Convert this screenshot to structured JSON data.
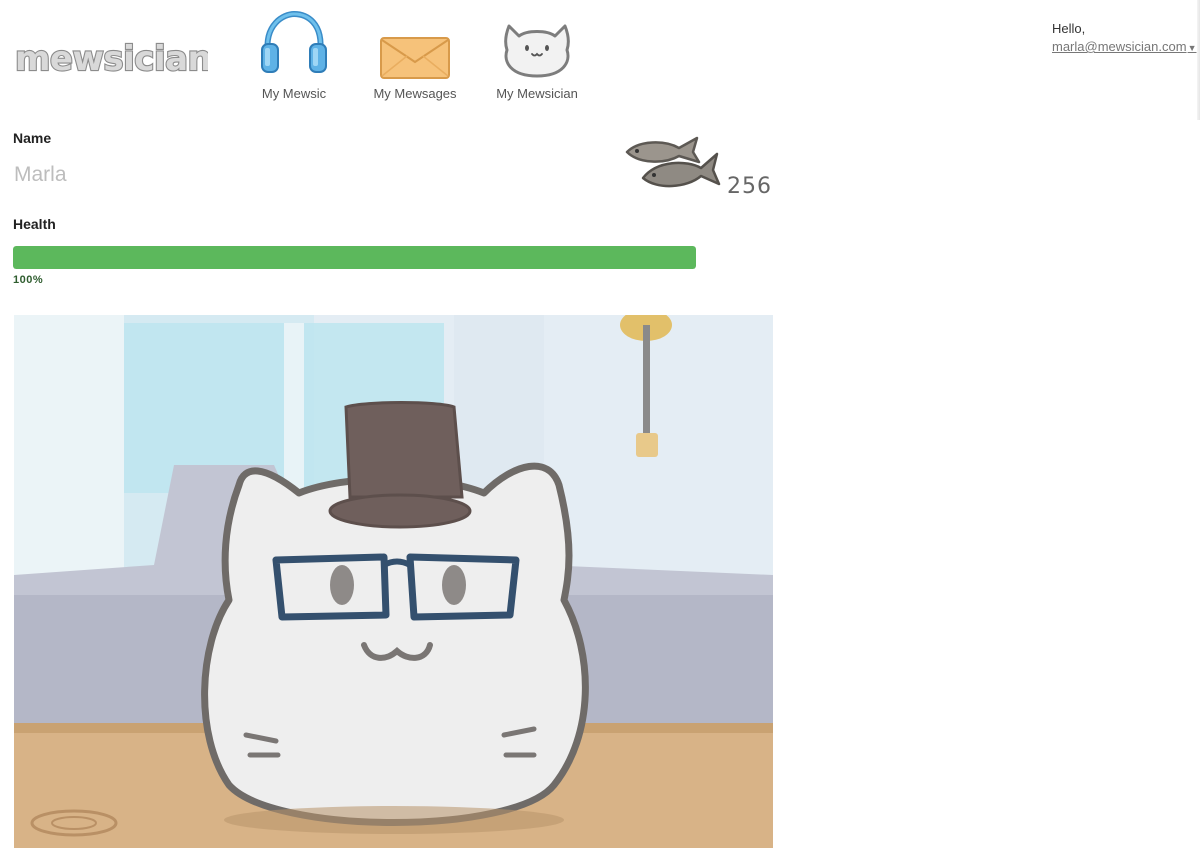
{
  "header": {
    "logo_text": "mewsician",
    "nav": [
      {
        "label": "My Mewsic",
        "icon": "headphones-icon"
      },
      {
        "label": "My Mewsages",
        "icon": "envelope-icon"
      },
      {
        "label": "My Mewsician",
        "icon": "cat-face-icon"
      }
    ],
    "greeting": "Hello,",
    "user_email": "marla@mewsician.com",
    "user_menu_icon": "caret-down-icon"
  },
  "profile": {
    "name_label": "Name",
    "name_value": "Marla",
    "coins_icon": "fish-icon",
    "coins": "256",
    "health_label": "Health",
    "health_percent": "100%",
    "health_value": 1.0,
    "health_color": "#5cb85c"
  },
  "scene": {
    "image": "cat-with-top-hat-and-glasses"
  }
}
